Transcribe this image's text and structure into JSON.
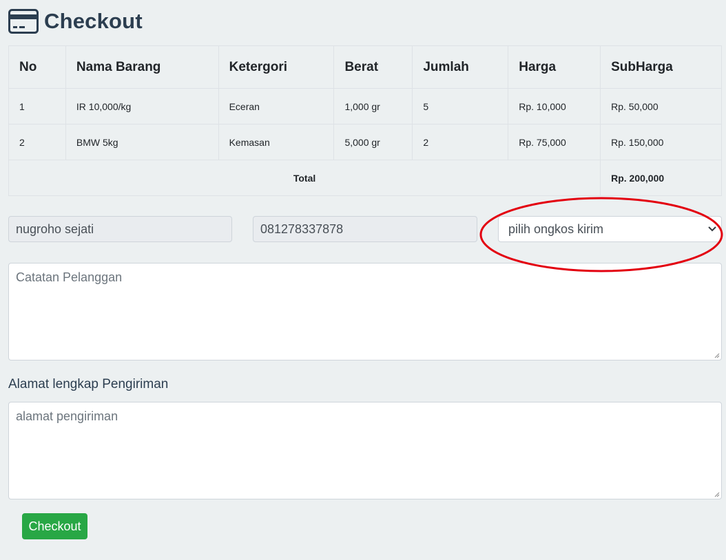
{
  "page": {
    "title": "Checkout",
    "icon": "credit-card-icon"
  },
  "table": {
    "headers": [
      "No",
      "Nama Barang",
      "Ketergori",
      "Berat",
      "Jumlah",
      "Harga",
      "SubHarga"
    ],
    "rows": [
      [
        "1",
        "IR 10,000/kg",
        "Eceran",
        "1,000 gr",
        "5",
        "Rp. 10,000",
        "Rp. 50,000"
      ],
      [
        "2",
        "BMW 5kg",
        "Kemasan",
        "5,000 gr",
        "2",
        "Rp. 75,000",
        "Rp. 150,000"
      ]
    ],
    "total_label": "Total",
    "total_value": "Rp. 200,000"
  },
  "form": {
    "name_value": "nugroho sejati",
    "phone_value": "081278337878",
    "shipping_selected": "pilih ongkos kirim",
    "notes_placeholder": "Catatan Pelanggan",
    "address_label": "Alamat lengkap Pengiriman",
    "address_placeholder": "alamat pengiriman",
    "submit_label": "Checkout"
  },
  "colors": {
    "background": "#ecf0f1",
    "title": "#2c3e50",
    "button": "#28a745",
    "annotation": "#e3000f"
  }
}
